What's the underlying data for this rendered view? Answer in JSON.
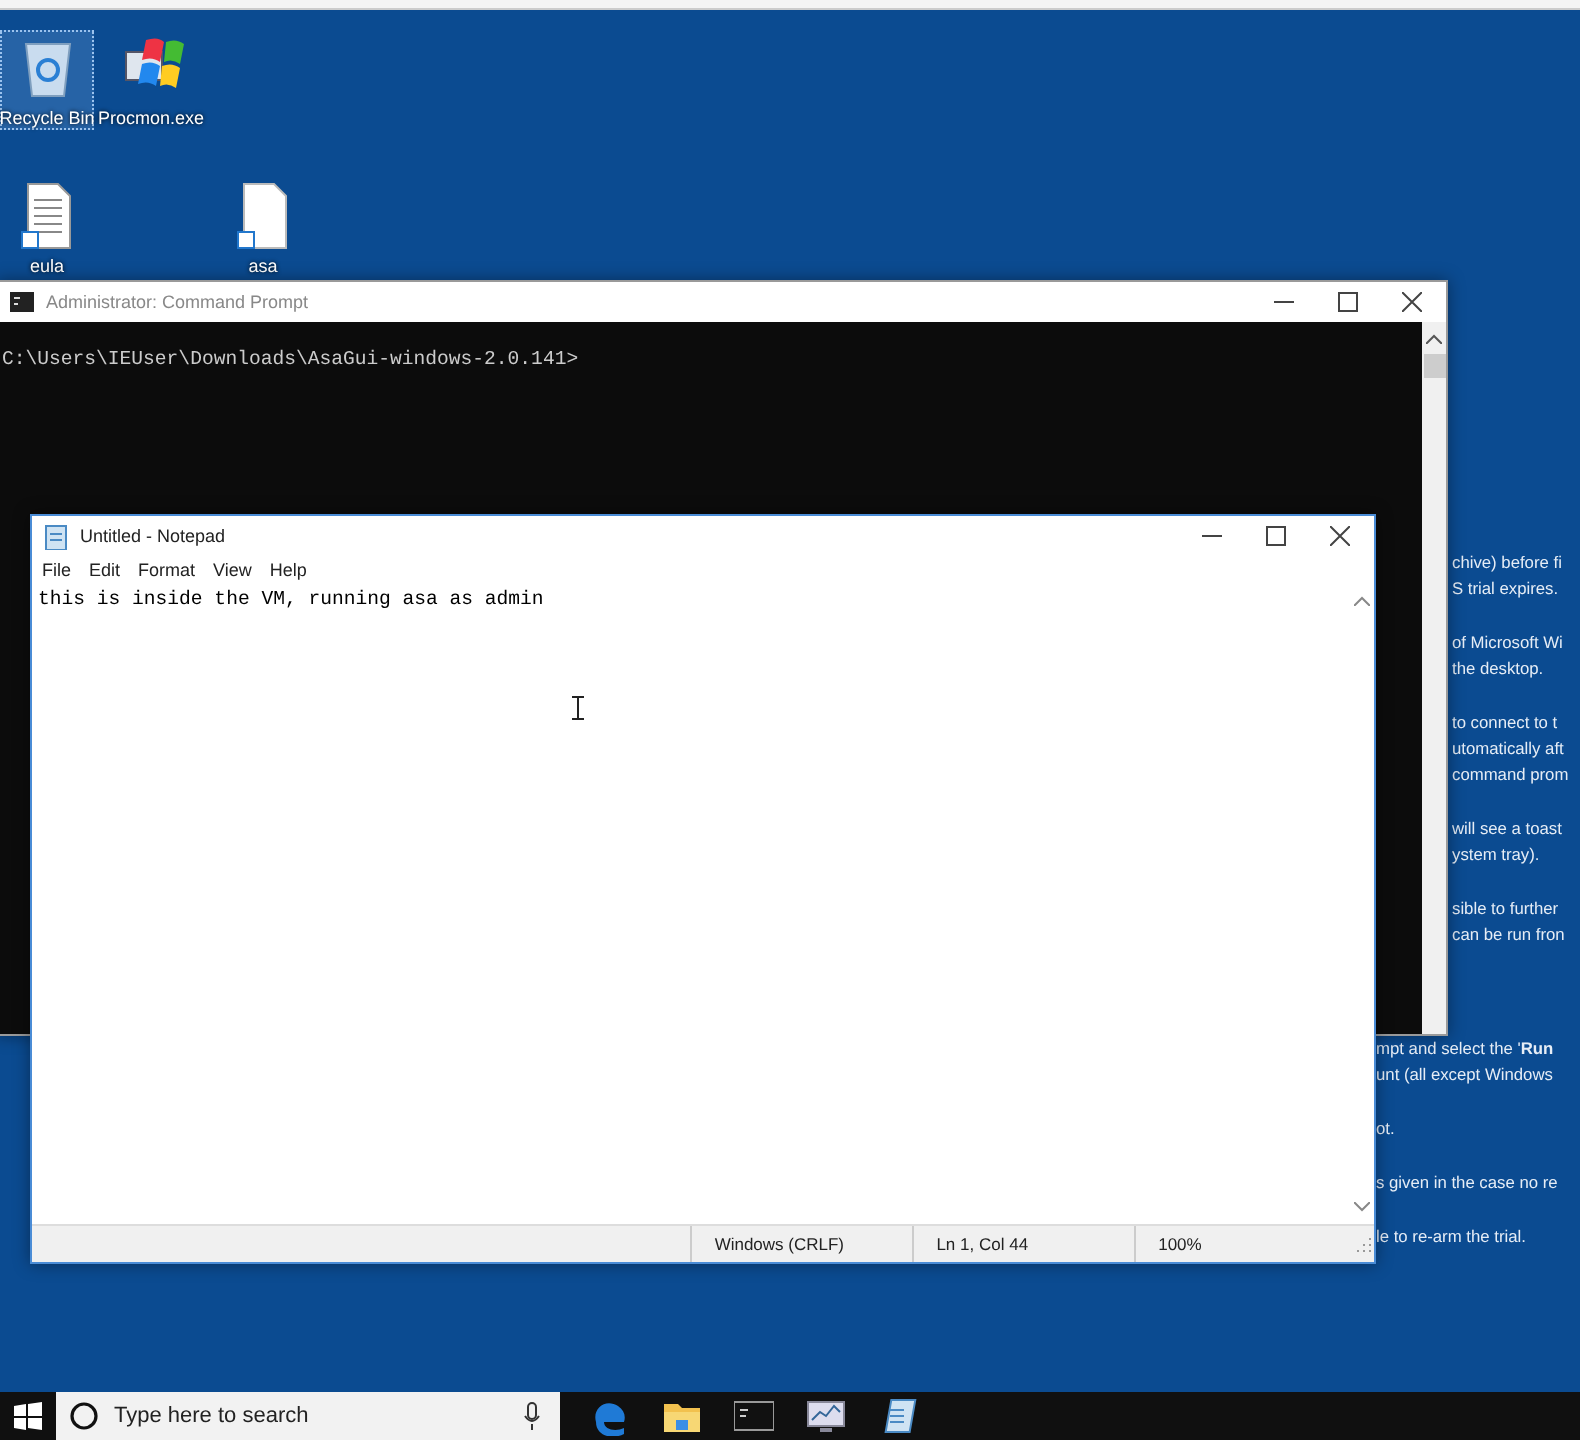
{
  "desktop_icons": [
    {
      "label": "Recycle Bin",
      "kind": "recycle-bin",
      "selected": true
    },
    {
      "label": "Procmon.exe",
      "kind": "program",
      "selected": false
    },
    {
      "label": "eula",
      "kind": "text-document",
      "selected": false
    },
    {
      "label": "asa",
      "kind": "blank-document",
      "selected": false
    }
  ],
  "notes_beside_console": [
    [
      "chive) before fi",
      "S trial expires."
    ],
    [
      "of Microsoft Wi",
      "the desktop."
    ],
    [
      "to connect to t",
      "utomatically aft",
      "command prom"
    ],
    [
      "will see a toast",
      "ystem tray)."
    ],
    [
      "sible to further",
      "can be run fron"
    ]
  ],
  "notes_below_console": [
    [
      "mpt and select the '**Run**",
      "unt (all except Windows"
    ],
    [
      "ot."
    ],
    [
      "s given in the case no re"
    ],
    [
      "le to re-arm the trial."
    ]
  ],
  "console_window": {
    "title": "Administrator: Command Prompt",
    "lines": [
      "C:\\Users\\IEUser\\Downloads\\AsaGui-windows-2.0.141>"
    ]
  },
  "notepad_window": {
    "title": "Untitled - Notepad",
    "menu": [
      "File",
      "Edit",
      "Format",
      "View",
      "Help"
    ],
    "text": "this is inside the VM, running asa as admin",
    "status_bar": [
      "Windows (CRLF)",
      "Ln 1, Col 44",
      "100%"
    ]
  },
  "taskbar": {
    "search": {
      "placeholder": "Type here to search"
    },
    "apps": [
      {
        "kind": "edge"
      },
      {
        "kind": "folder"
      },
      {
        "kind": "console"
      },
      {
        "kind": "monitor"
      },
      {
        "kind": "notepad"
      }
    ]
  }
}
